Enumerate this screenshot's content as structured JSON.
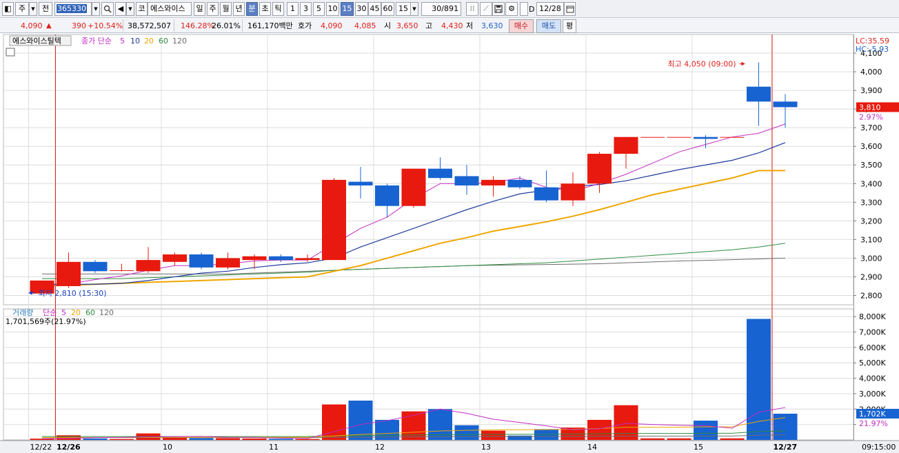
{
  "toolbar": {
    "market": "주",
    "view": "전",
    "code": "365330",
    "icon_search": "search-icon",
    "icon_speaker": "speaker-icon",
    "kor_label": "코",
    "name": "에스와이스",
    "periods": [
      "일",
      "주",
      "월",
      "년",
      "분",
      "초",
      "틱"
    ],
    "active_period": "분",
    "intervals": [
      "1",
      "3",
      "5",
      "10",
      "15",
      "30",
      "45",
      "60"
    ],
    "active_interval": "15",
    "interval_value": "15",
    "count": "30/891",
    "icon_tools": "drawing-tools-icon",
    "icon_save": "save-icon",
    "icon_settings": "gear-icon",
    "d_label": "D",
    "date": "12/28",
    "icon_calendar": "calendar-icon"
  },
  "quote": {
    "price": "4,090",
    "change": "390",
    "change_pct": "+10.54%",
    "volume": "38,572,507",
    "vol_ratio": "146.28%",
    "turnover": "26.01%",
    "amount": "161,170백만",
    "bid_label": "호가",
    "ask": "4,090",
    "bid": "4,085",
    "open_label": "시",
    "open": "3,650",
    "high_label": "고",
    "high": "4,430",
    "low_label": "저",
    "low": "3,630",
    "buy_label": "매수",
    "sell_label": "매도",
    "eval_label": "평"
  },
  "colors": {
    "up": "#e8190e",
    "down": "#1763d1",
    "ma5": "#c22bc2",
    "ma10": "#1d3a9e",
    "ma20": "#f0a500",
    "ma60": "#2e8b3e",
    "ma120": "#6b6b6b",
    "grid": "#dcdcdc",
    "marker": "#e0201b"
  },
  "chart_data": [
    {
      "type": "candlestick",
      "title": "에스와이스틸텍",
      "indicator_label": "종가 단순",
      "ma_periods": [
        "5",
        "10",
        "20",
        "60",
        "120"
      ],
      "corner_labels": [
        "LC:35.59",
        "HC:-5.93"
      ],
      "ylim": [
        2750,
        4200
      ],
      "y_ticks": [
        2800,
        2900,
        3000,
        3100,
        3200,
        3300,
        3400,
        3500,
        3600,
        3700,
        3800,
        3900,
        4000,
        4100
      ],
      "y_tick_labels": [
        "2,800",
        "2,900",
        "3,000",
        "3,100",
        "3,200",
        "3,300",
        "3,400",
        "3,500",
        "3,600",
        "3,700",
        "3,800",
        "3,900",
        "4,000",
        "4,100"
      ],
      "current_price": 3810,
      "current_label": "3,810",
      "current_pct": "2.97%",
      "high_annotation": "최고 4,050 (09:00)",
      "low_annotation": "최저 2,810 (15:30)",
      "candles": [
        {
          "o": 2810,
          "c": 2880,
          "h": 2880,
          "l": 2810
        },
        {
          "o": 2850,
          "c": 2980,
          "h": 3030,
          "l": 2840
        },
        {
          "o": 2980,
          "c": 2930,
          "h": 2990,
          "l": 2920
        },
        {
          "o": 2935,
          "c": 2935,
          "h": 2970,
          "l": 2930
        },
        {
          "o": 2930,
          "c": 2990,
          "h": 3060,
          "l": 2920
        },
        {
          "o": 2980,
          "c": 3020,
          "h": 3030,
          "l": 2960
        },
        {
          "o": 3020,
          "c": 2950,
          "h": 3030,
          "l": 2940
        },
        {
          "o": 2950,
          "c": 3000,
          "h": 3030,
          "l": 2940
        },
        {
          "o": 2990,
          "c": 3010,
          "h": 3020,
          "l": 2940
        },
        {
          "o": 3010,
          "c": 2990,
          "h": 3020,
          "l": 2980
        },
        {
          "o": 2990,
          "c": 3000,
          "h": 3020,
          "l": 2980
        },
        {
          "o": 2990,
          "c": 3420,
          "h": 3430,
          "l": 2990
        },
        {
          "o": 3410,
          "c": 3390,
          "h": 3490,
          "l": 3320
        },
        {
          "o": 3390,
          "c": 3280,
          "h": 3400,
          "l": 3220
        },
        {
          "o": 3280,
          "c": 3480,
          "h": 3480,
          "l": 3270
        },
        {
          "o": 3480,
          "c": 3430,
          "h": 3540,
          "l": 3420
        },
        {
          "o": 3440,
          "c": 3390,
          "h": 3500,
          "l": 3340
        },
        {
          "o": 3390,
          "c": 3420,
          "h": 3440,
          "l": 3330
        },
        {
          "o": 3420,
          "c": 3380,
          "h": 3440,
          "l": 3370
        },
        {
          "o": 3380,
          "c": 3310,
          "h": 3470,
          "l": 3300
        },
        {
          "o": 3310,
          "c": 3400,
          "h": 3460,
          "l": 3280
        },
        {
          "o": 3400,
          "c": 3560,
          "h": 3570,
          "l": 3350
        },
        {
          "o": 3560,
          "c": 3650,
          "h": 3650,
          "l": 3480
        },
        {
          "o": 3650,
          "c": 3650,
          "h": 3650,
          "l": 3650
        },
        {
          "o": 3650,
          "c": 3650,
          "h": 3650,
          "l": 3650
        },
        {
          "o": 3650,
          "c": 3640,
          "h": 3660,
          "l": 3590
        },
        {
          "o": 3650,
          "c": 3650,
          "h": 3650,
          "l": 3650
        },
        {
          "o": 3920,
          "c": 3840,
          "h": 4050,
          "l": 3710
        },
        {
          "o": 3840,
          "c": 3810,
          "h": 3880,
          "l": 3700
        }
      ],
      "ma": {
        "5": [
          2845,
          2862,
          2885,
          2905,
          2935,
          2960,
          2960,
          2970,
          2985,
          2990,
          2990,
          3075,
          3160,
          3220,
          3320,
          3400,
          3400,
          3405,
          3430,
          3380,
          3360,
          3400,
          3450,
          3510,
          3570,
          3610,
          3650,
          3670,
          3720
        ],
        "10": [
          2860,
          2860,
          2860,
          2865,
          2880,
          2900,
          2920,
          2930,
          2950,
          2965,
          2975,
          3000,
          3060,
          3110,
          3160,
          3210,
          3260,
          3305,
          3345,
          3365,
          3385,
          3395,
          3415,
          3445,
          3475,
          3500,
          3525,
          3565,
          3620
        ],
        "20": [
          2850,
          2855,
          2860,
          2865,
          2870,
          2875,
          2880,
          2885,
          2890,
          2895,
          2900,
          2930,
          2960,
          3000,
          3040,
          3080,
          3110,
          3145,
          3170,
          3195,
          3225,
          3260,
          3300,
          3340,
          3370,
          3400,
          3430,
          3470,
          3470
        ],
        "60": [
          2890,
          2890,
          2890,
          2890,
          2895,
          2900,
          2905,
          2910,
          2915,
          2920,
          2925,
          2935,
          2940,
          2945,
          2950,
          2955,
          2960,
          2965,
          2970,
          2975,
          2985,
          2995,
          3005,
          3015,
          3025,
          3035,
          3045,
          3060,
          3080
        ],
        "120": [
          2915,
          2915,
          2915,
          2915,
          2915,
          2915,
          2915,
          2915,
          2920,
          2925,
          2930,
          2935,
          2940,
          2945,
          2950,
          2955,
          2960,
          2962,
          2964,
          2966,
          2968,
          2970,
          2975,
          2980,
          2985,
          2988,
          2992,
          2996,
          3000
        ]
      }
    },
    {
      "type": "bar",
      "title": "거래량",
      "indicator_label": "단순",
      "ma_periods": [
        "5",
        "20",
        "60",
        "120"
      ],
      "info": "1,701,569주(21.97%)",
      "ylim": [
        0,
        8500000
      ],
      "y_ticks": [
        1000000,
        2000000,
        3000000,
        4000000,
        5000000,
        6000000,
        7000000,
        8000000
      ],
      "y_tick_labels": [
        "",
        "2,000K",
        "3,000K",
        "4,000K",
        "5,000K",
        "6,000K",
        "7,000K",
        "8,000K"
      ],
      "current_label": "1,702K",
      "current_value": 1702000,
      "current_pct": "21.97%",
      "values": [
        80000,
        300000,
        90000,
        60000,
        420000,
        160000,
        120000,
        110000,
        90000,
        70000,
        60000,
        2300000,
        2550000,
        1300000,
        1850000,
        2000000,
        950000,
        600000,
        280000,
        700000,
        800000,
        1300000,
        2250000,
        100000,
        100000,
        1250000,
        100000,
        7850000,
        1700000
      ],
      "ma": {
        "5": [
          80000,
          100000,
          150000,
          160000,
          200000,
          210000,
          230000,
          170000,
          160000,
          120000,
          90000,
          530000,
          1000000,
          1250000,
          1600000,
          2000000,
          1720000,
          1340000,
          1130000,
          910000,
          660000,
          720000,
          1070000,
          1000000,
          950000,
          920000,
          760000,
          1800000,
          2100000
        ],
        "20": [
          150000,
          150000,
          150000,
          160000,
          170000,
          170000,
          170000,
          170000,
          170000,
          170000,
          170000,
          260000,
          350000,
          420000,
          500000,
          580000,
          620000,
          650000,
          660000,
          670000,
          690000,
          740000,
          820000,
          820000,
          820000,
          850000,
          850000,
          1200000,
          1450000
        ],
        "60": [
          220000,
          220000,
          220000,
          220000,
          220000,
          220000,
          220000,
          220000,
          220000,
          220000,
          220000,
          250000,
          280000,
          300000,
          320000,
          340000,
          350000,
          360000,
          365000,
          370000,
          380000,
          395000,
          420000,
          420000,
          420000,
          430000,
          430000,
          540000,
          580000
        ],
        "120": [
          150000,
          150000,
          150000,
          150000,
          150000,
          150000,
          150000,
          150000,
          150000,
          150000,
          150000,
          160000,
          175000,
          185000,
          195000,
          205000,
          210000,
          215000,
          218000,
          221000,
          226000,
          233000,
          245000,
          245000,
          245000,
          250000,
          250000,
          305000,
          325000
        ]
      }
    }
  ],
  "x_axis": {
    "labels": [
      {
        "index": 0,
        "text": "12/22"
      },
      {
        "index": 1,
        "text": "12/26"
      },
      {
        "index": 5,
        "text": "10"
      },
      {
        "index": 9,
        "text": "11"
      },
      {
        "index": 13,
        "text": "12"
      },
      {
        "index": 17,
        "text": "13"
      },
      {
        "index": 21,
        "text": "14"
      },
      {
        "index": 25,
        "text": "15"
      },
      {
        "index": 28,
        "text": "12/27"
      }
    ],
    "time_label": "09:15:00",
    "day_markers": [
      1,
      28
    ]
  }
}
